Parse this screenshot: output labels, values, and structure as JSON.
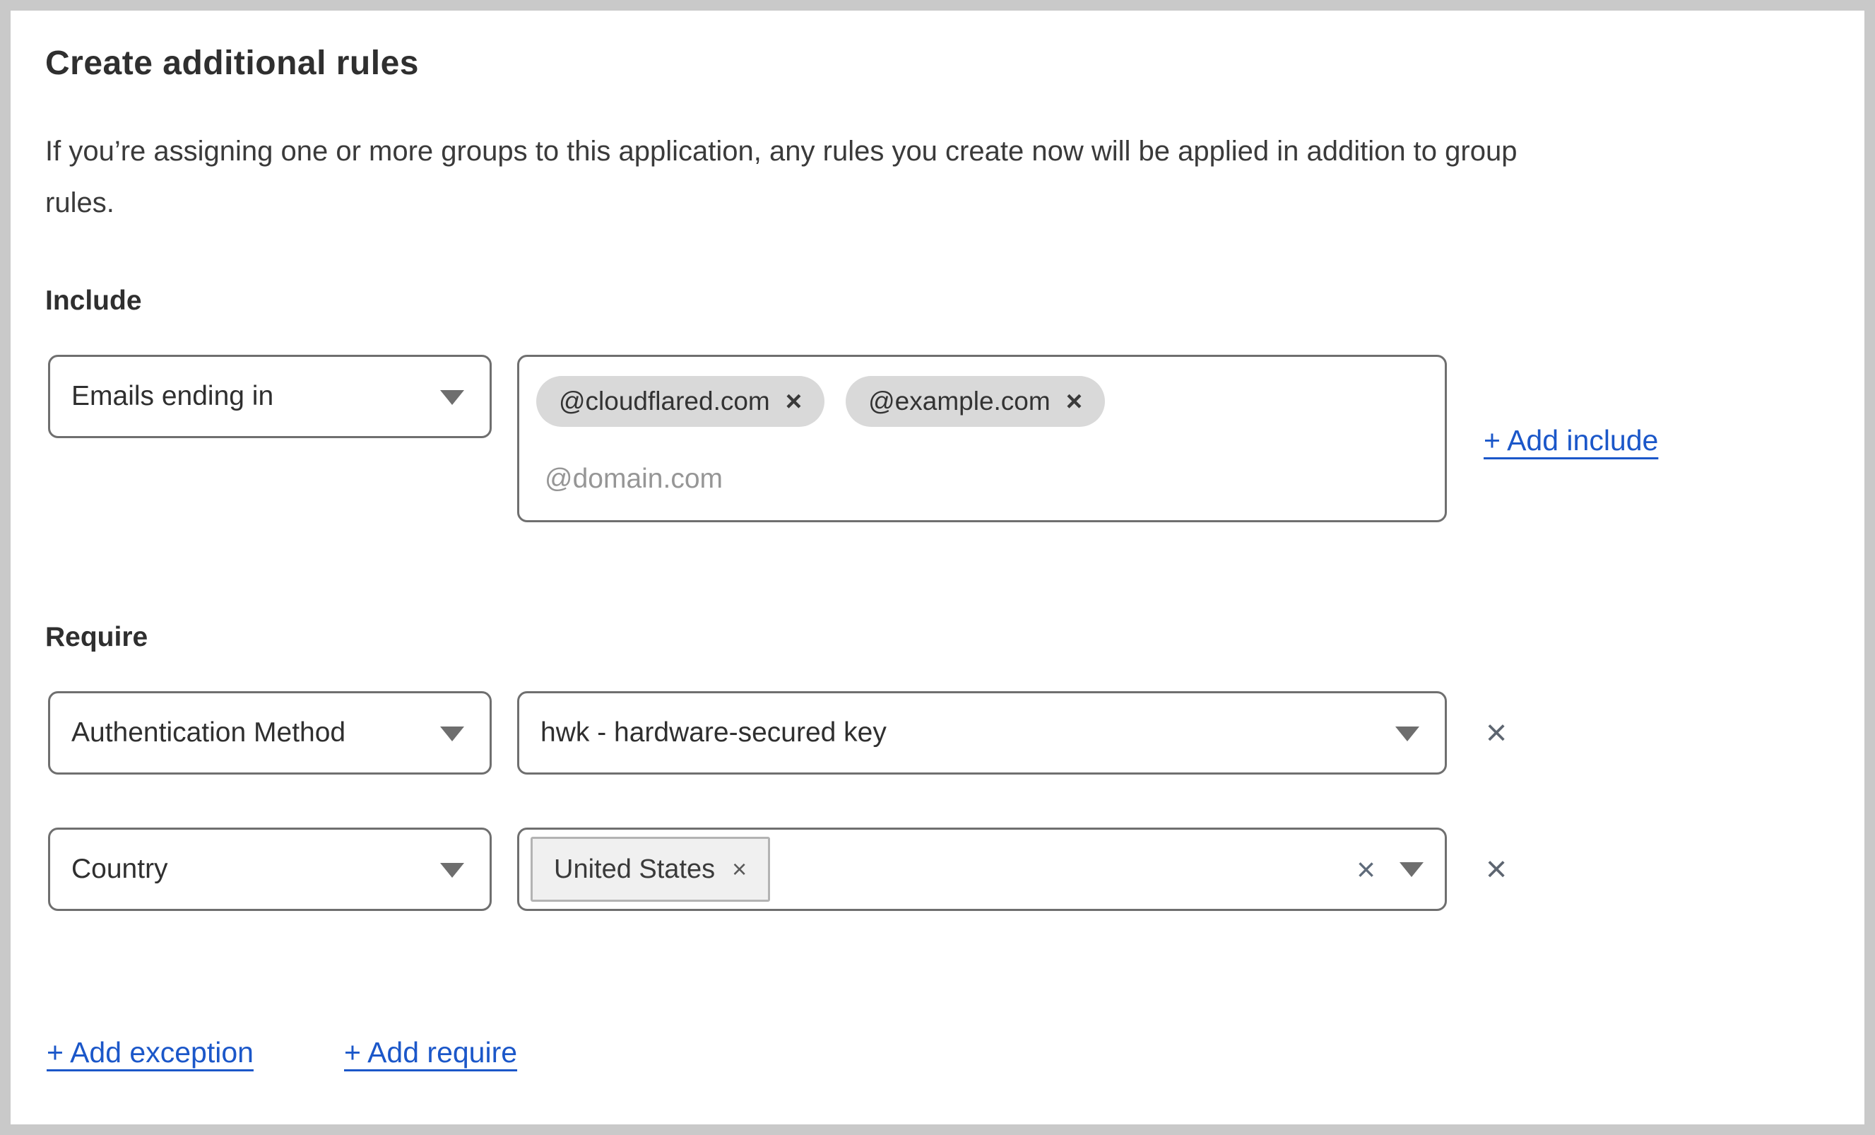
{
  "panel": {
    "title": "Create additional rules",
    "description_line1": "If you’re assigning one or more groups to this application, any rules you create now will be applied in addition to group",
    "description_line2": "rules."
  },
  "include": {
    "label": "Include",
    "selector_value": "Emails ending in",
    "chips": [
      {
        "label": "@cloudflared.com",
        "remove_icon": "×"
      },
      {
        "label": "@example.com",
        "remove_icon": "×"
      }
    ],
    "input_placeholder": "@domain.com",
    "add_link_label": "+ Add include"
  },
  "require": {
    "label": "Require",
    "rules": [
      {
        "selector_value": "Authentication Method",
        "value": "hwk - hardware-secured key",
        "remove_icon": "×"
      },
      {
        "selector_value": "Country",
        "chips": [
          {
            "label": "United States",
            "remove_icon": "×"
          }
        ],
        "clear_icon": "×",
        "remove_icon": "×"
      }
    ]
  },
  "footer": {
    "add_exception_label": "+ Add exception",
    "add_require_label": "+ Add require"
  },
  "icons": {
    "dropdown_chevron_icon": "css-triangle-down",
    "remove_icon_glyph": "×"
  },
  "colors": {
    "link_blue": "#1b57c9",
    "control_border": "#6f6f6f",
    "chip_background": "#d9d9d9",
    "country_chip_background": "#f0f0f0",
    "frame_border": "#c9c9c9",
    "placeholder_gray": "#969696",
    "text": "#333333"
  }
}
